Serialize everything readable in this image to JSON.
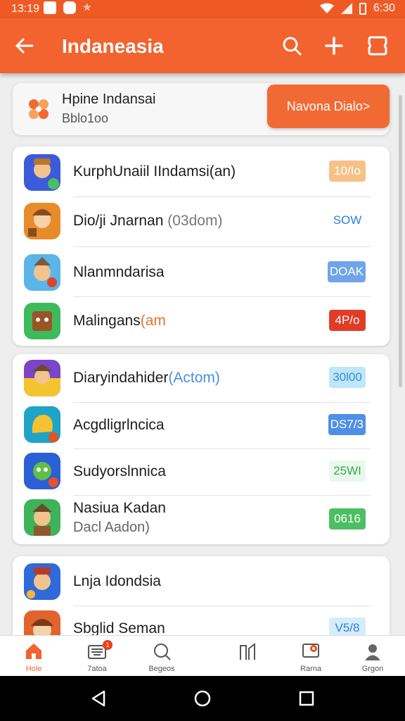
{
  "status_bar": {
    "time": "13:19",
    "battery": "6:30"
  },
  "app_bar": {
    "title": "Indaneasia"
  },
  "promo": {
    "title": "Hpine Indansai",
    "subtitle": "Bblo1oo",
    "button_label": "Navona Dialo>"
  },
  "groups": [
    {
      "items": [
        {
          "name": "KurphUnaiil IIndamsi(an)",
          "extra": "",
          "badge": "10/Io",
          "badge_bg": "#f6c187",
          "badge_fg": "#ffffff",
          "icon_bg": "#3b5bdc"
        },
        {
          "name": "Dio/ji Jnarnan",
          "extra": " (03dom)",
          "badge": "SOW",
          "badge_bg": "#ffffff",
          "badge_fg": "#2f7fe0",
          "icon_bg": "#e88b2a"
        },
        {
          "name": "Nlanmndarisa",
          "extra": "",
          "badge": "DOAK",
          "badge_bg": "#6fa5e8",
          "badge_fg": "#ffffff",
          "icon_bg": "#5bb5e8"
        },
        {
          "name": "Malingans",
          "extra": "(am",
          "badge": "4P/o",
          "badge_bg": "#e23b26",
          "badge_fg": "#ffffff",
          "icon_bg": "#3dbb5a"
        }
      ]
    },
    {
      "items": [
        {
          "name": "Diaryindahider",
          "extra": "(Actom)",
          "badge": "30l00",
          "badge_bg": "#bfe6fa",
          "badge_fg": "#3a8fd0",
          "icon_bg": "#7a45c8"
        },
        {
          "name": "Acgdligrlncica",
          "extra": "",
          "badge": "DS7/3",
          "badge_bg": "#4f8fe6",
          "badge_fg": "#ffffff",
          "icon_bg": "#1fa4c8"
        },
        {
          "name": "Sudyorslnnica",
          "extra": "",
          "badge": "25WI",
          "badge_bg": "#eaf8ec",
          "badge_fg": "#37a84f",
          "icon_bg": "#2c5fd6"
        },
        {
          "name": "Nasiua Kadan",
          "extra": "",
          "sub": "Dacl Aadon)",
          "badge": "0616",
          "badge_bg": "#4cbf62",
          "badge_fg": "#ffffff",
          "icon_bg": "#3fb35a"
        }
      ]
    },
    {
      "items": [
        {
          "name": "Lnja Idondsia",
          "extra": "",
          "badge": "",
          "badge_bg": "",
          "badge_fg": "",
          "icon_bg": "#2f6ad8"
        },
        {
          "name": "Sbglid Seman",
          "extra": "",
          "badge": "V5/8",
          "badge_bg": "#d5ecfb",
          "badge_fg": "#2f7fe0",
          "icon_bg": "#e0642c"
        }
      ]
    }
  ],
  "bottom_nav": [
    {
      "label": "Hole",
      "icon": "home-icon",
      "active": true
    },
    {
      "label": "7atoa",
      "icon": "keyboard-icon",
      "badge": "1"
    },
    {
      "label": "Begeos",
      "icon": "search-icon"
    },
    {
      "label": "",
      "icon": "chart-icon"
    },
    {
      "label": "Rarna",
      "icon": "screen-icon"
    },
    {
      "label": "Grgon",
      "icon": "user-icon"
    }
  ],
  "colors": {
    "accent": "#f26330",
    "active_nav": "#f26330"
  }
}
